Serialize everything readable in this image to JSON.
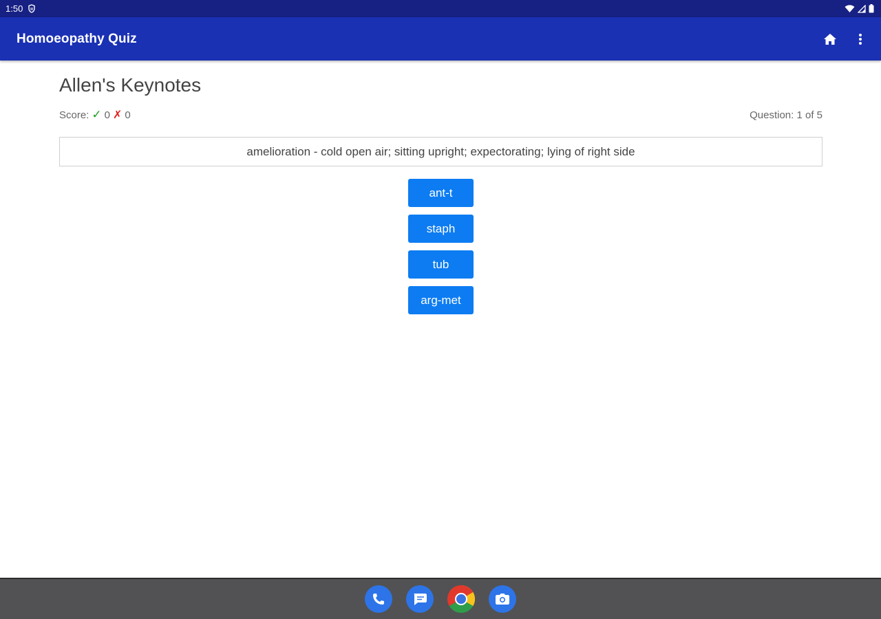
{
  "status_bar": {
    "time": "1:50",
    "icons": [
      "shield-icon",
      "wifi-icon",
      "signal-icon",
      "battery-icon"
    ]
  },
  "app_bar": {
    "title": "Homoeopathy Quiz",
    "actions": [
      "home-icon",
      "more-vert-icon"
    ]
  },
  "quiz": {
    "title": "Allen's Keynotes",
    "score_label": "Score:",
    "correct_count": "0",
    "wrong_count": "0",
    "question_counter": "Question: 1 of 5",
    "question_text": "amelioration - cold open air; sitting upright; expectorating; lying of right side",
    "answers": [
      "ant-t",
      "staph",
      "tub",
      "arg-met"
    ]
  },
  "dock": {
    "apps": [
      "phone-icon",
      "messages-icon",
      "chrome-icon",
      "camera-icon"
    ]
  },
  "colors": {
    "status_bar": "#172083",
    "app_bar": "#1a31b3",
    "answer_button": "#0d7cf2",
    "correct": "#1e9e1e",
    "wrong": "#e0201e",
    "dock": "#525254"
  }
}
